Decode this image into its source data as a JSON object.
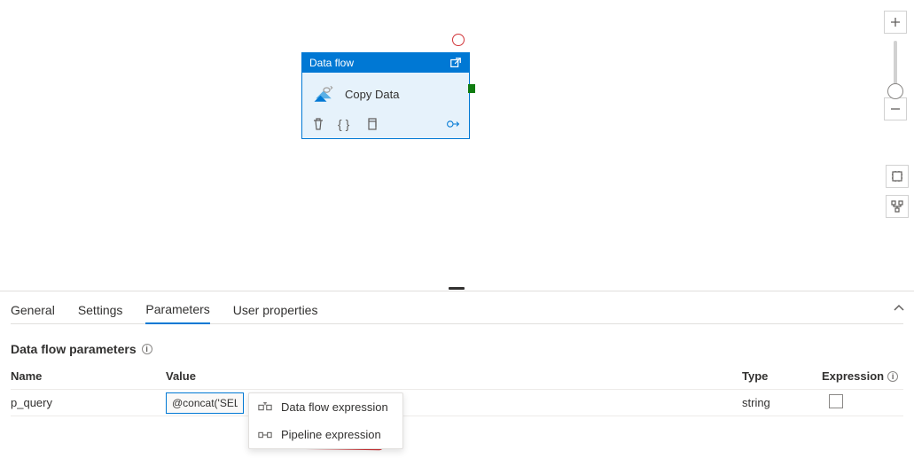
{
  "node": {
    "header": "Data flow",
    "title": "Copy Data"
  },
  "tabs": {
    "general": "General",
    "settings": "Settings",
    "parameters": "Parameters",
    "user_properties": "User properties"
  },
  "section": {
    "title": "Data flow parameters"
  },
  "columns": {
    "name": "Name",
    "value": "Value",
    "type": "Type",
    "expression": "Expression"
  },
  "row": {
    "name": "p_query",
    "value": "@concat('SEL",
    "type": "string"
  },
  "dropdown": {
    "dataflow": "Data flow expression",
    "pipeline": "Pipeline expression"
  }
}
